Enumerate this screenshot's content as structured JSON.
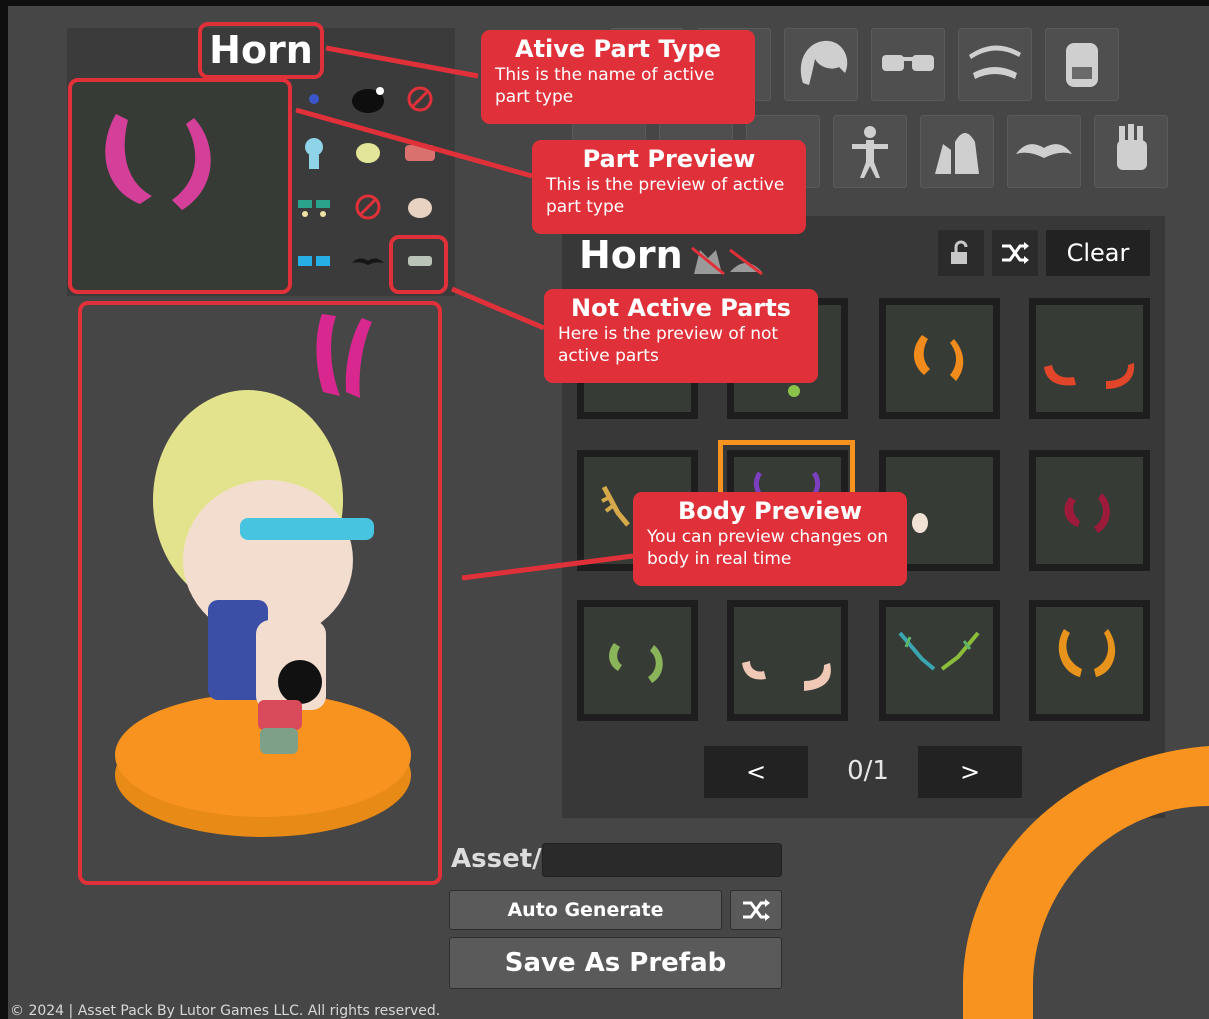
{
  "summary": {
    "title": "Horn"
  },
  "parts_panel": {
    "title": "Horn",
    "clear_label": "Clear",
    "page": "0/1",
    "prev_label": "<",
    "next_label": ">"
  },
  "asset": {
    "label": "Asset/",
    "value": ""
  },
  "buttons": {
    "auto_generate": "Auto Generate",
    "save_prefab": "Save As Prefab"
  },
  "annotations": {
    "active_part_type": {
      "title": "Ative Part Type",
      "body": "This is the name of active part type"
    },
    "part_preview": {
      "title": "Part Preview",
      "body": "This is the preview of active part type"
    },
    "not_active_parts": {
      "title": "Not Active Parts",
      "body": "Here is the preview of not active parts"
    },
    "body_preview": {
      "title": "Body Preview",
      "body": "You can preview changes on body in real time"
    }
  },
  "footer": "© 2024 | Asset Pack By Lutor Games LLC. All rights reserved.",
  "colors": {
    "annotation": "#e0313a",
    "accent": "#f7931e",
    "selected": "#f7931e",
    "panel": "#383838"
  },
  "icons": [
    "hair-icon",
    "glasses-icon",
    "eyebrow-icon",
    "backpack-icon",
    "body-icon",
    "outfit-icon",
    "mustache-icon",
    "glove-icon",
    "lock-icon",
    "shuffle-icon"
  ]
}
